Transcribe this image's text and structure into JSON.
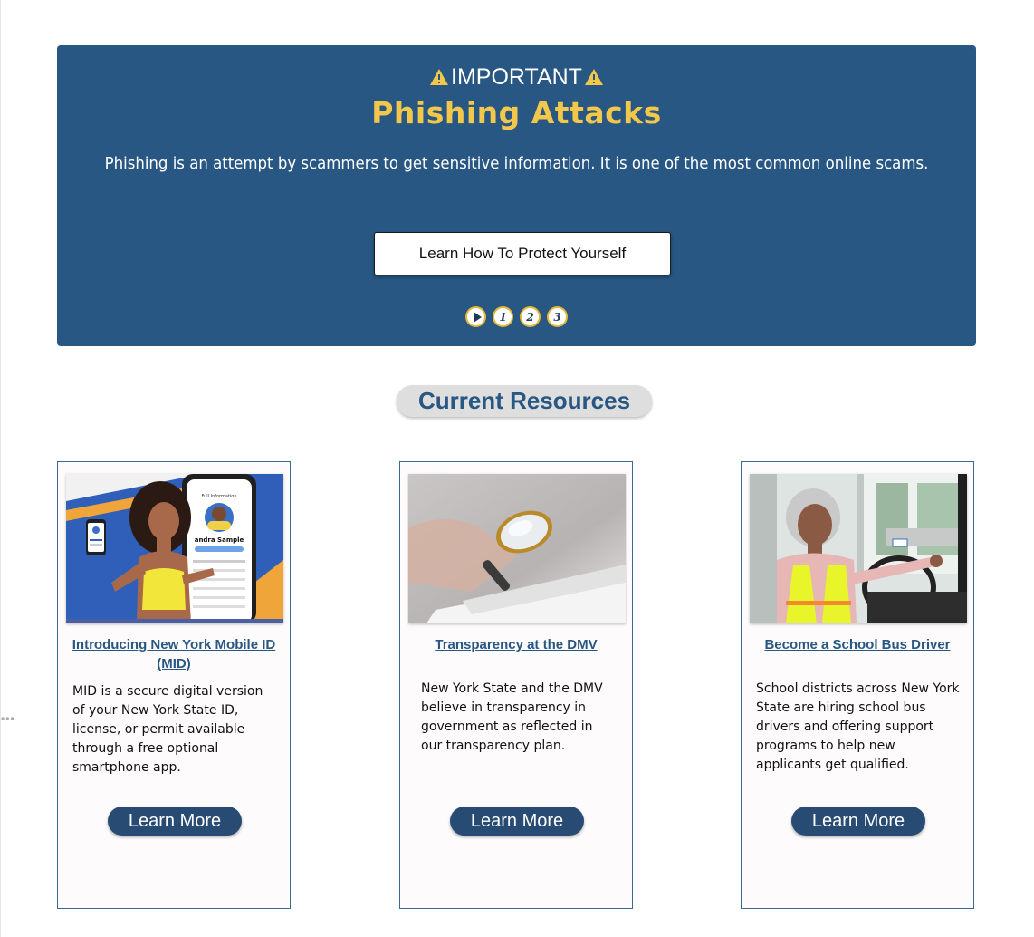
{
  "banner": {
    "kicker": "IMPORTANT",
    "title": "Phishing Attacks",
    "text": "Phishing is an attempt by scammers to get sensitive information. It is one of the most common online scams.",
    "button_label": "Learn How To Protect Yourself",
    "slides": [
      "1",
      "2",
      "3"
    ]
  },
  "resources": {
    "heading": "Current Resources",
    "cards": [
      {
        "title": "Introducing New York Mobile ID (MID)",
        "text": "MID is a secure digital version of your New York State ID, license, or permit available through a free optional smartphone app.",
        "button_label": "Learn More",
        "phone_label": "Full Information",
        "phone_name": "andra Sample"
      },
      {
        "title": "Transparency at the DMV",
        "text": "New York State and the DMV believe in transparency in government as reflected in our transparency plan.",
        "button_label": "Learn More"
      },
      {
        "title": "Become a School Bus Driver",
        "text": "School districts across New York State are hiring school bus drivers and offering support programs to help new applicants get qualified.",
        "button_label": "Learn More"
      }
    ]
  },
  "colors": {
    "banner_bg": "#275782",
    "accent_yellow": "#f3c74a",
    "button_dark": "#274b72"
  }
}
